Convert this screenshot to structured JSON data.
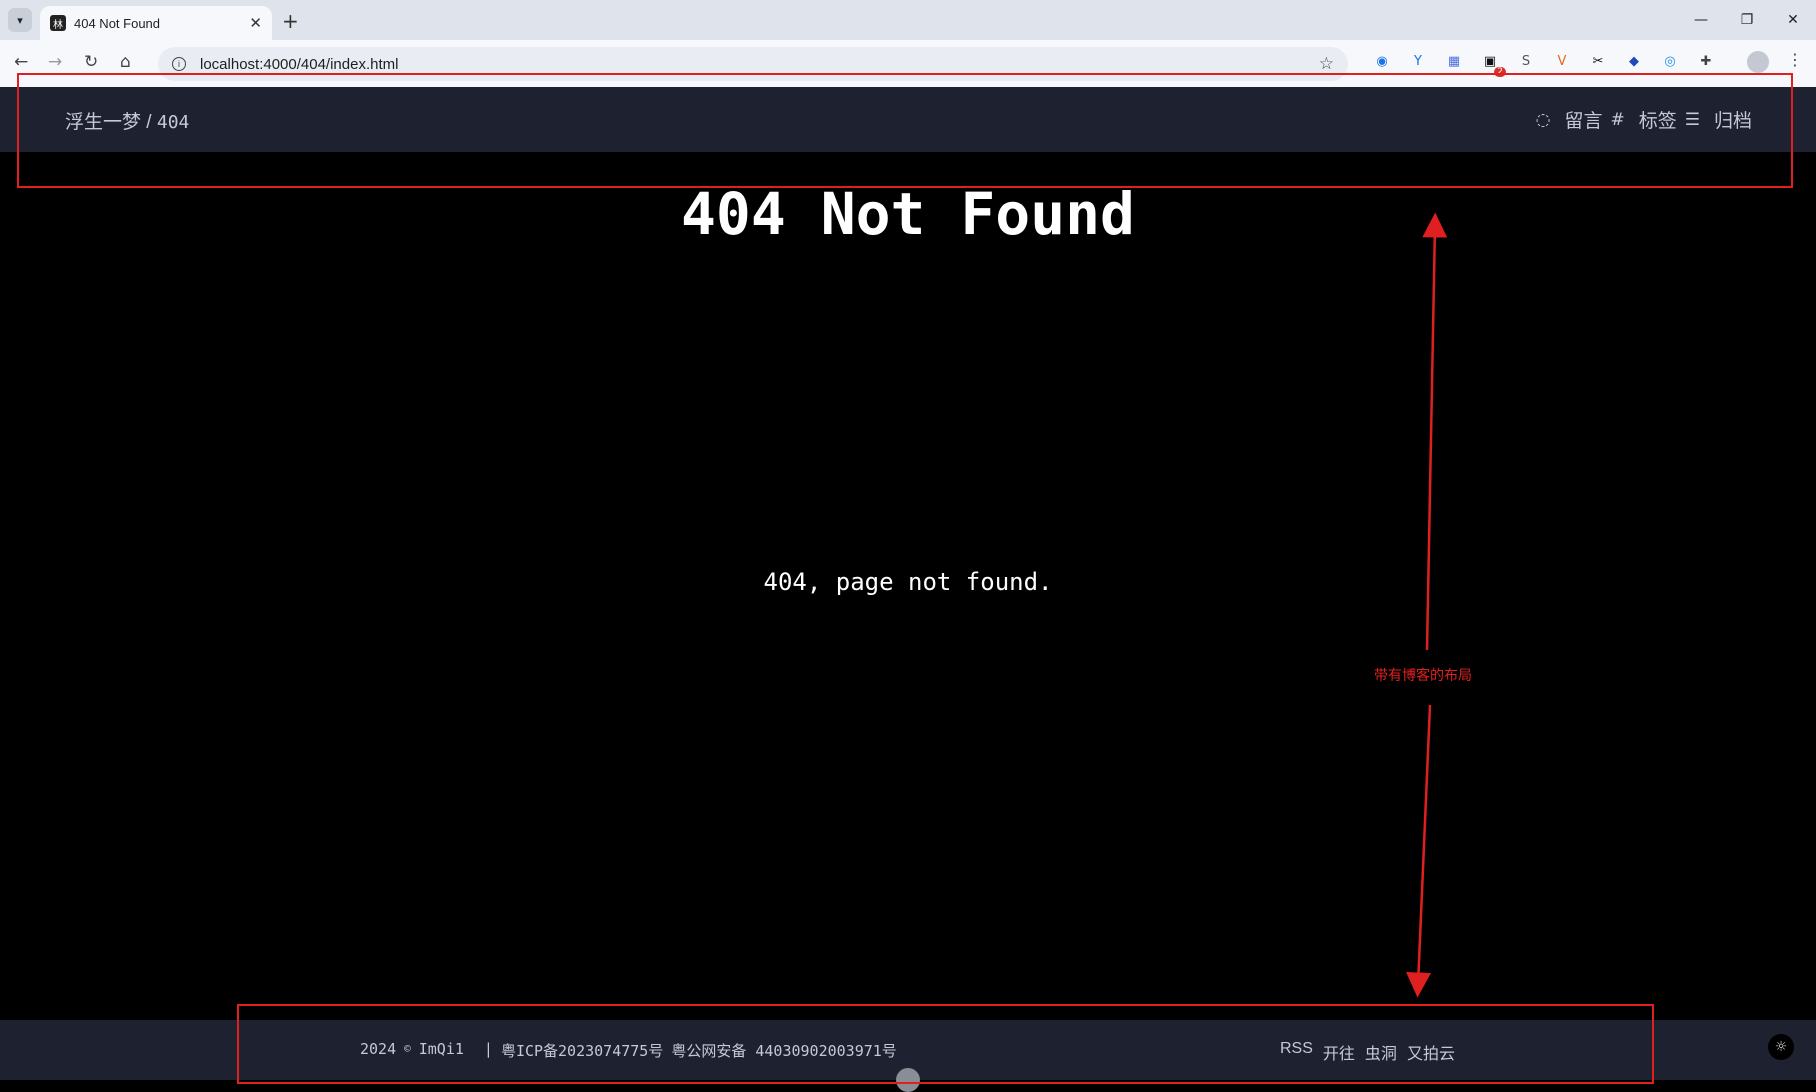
{
  "browser": {
    "tab_list_icon": "chevron-down-icon",
    "tab": {
      "favicon_text": "林",
      "title": "404 Not Found",
      "close": "✕"
    },
    "new_tab": "+",
    "window_controls": {
      "minimize": "—",
      "restore": "❐",
      "close": "✕"
    },
    "nav": {
      "back": "←",
      "forward": "→",
      "reload": "↻",
      "home": "⌂"
    },
    "url": "localhost:4000/404/index.html",
    "bookmark_star": "☆",
    "extensions": [
      {
        "name": "chrome-ext-icon",
        "glyph": "◉",
        "color": "#1a73e8"
      },
      {
        "name": "v-ext-icon",
        "glyph": "Y",
        "color": "#1a73e8"
      },
      {
        "name": "grid-ext-icon",
        "glyph": "▦",
        "color": "#4a6fdc"
      },
      {
        "name": "chat-ext-icon",
        "glyph": "▣",
        "color": "#111",
        "badge": "2"
      },
      {
        "name": "s-ext-icon",
        "glyph": "S",
        "color": "#555"
      },
      {
        "name": "v-logo-ext-icon",
        "glyph": "V",
        "color": "#e06a1b"
      },
      {
        "name": "scissors-ext-icon",
        "glyph": "✂",
        "color": "#111"
      },
      {
        "name": "circle-ext-icon",
        "glyph": "◆",
        "color": "#1e4bb8"
      },
      {
        "name": "eye-ext-icon",
        "glyph": "◎",
        "color": "#1e8ee8"
      },
      {
        "name": "puzzle-ext-icon",
        "glyph": "✚",
        "color": "#444"
      }
    ],
    "menu": "⋮"
  },
  "site": {
    "brand": "浮生一梦",
    "separator": "/",
    "page": "404",
    "nav": [
      {
        "icon": "comment-icon",
        "glyph": "◌",
        "label": "留言"
      },
      {
        "icon": "hashtag-icon",
        "glyph": "#",
        "label": "标签"
      },
      {
        "icon": "list-icon",
        "glyph": "☰",
        "label": "归档"
      }
    ]
  },
  "main": {
    "title": "404 Not Found",
    "message": "404, page not found."
  },
  "footer": {
    "year": "2024",
    "copyright_symbol": "©",
    "author": "ImQi1",
    "divider": "|",
    "icp": "粤ICP备2023074775号",
    "police": "粤公网安备 44030902003971号",
    "links": [
      "RSS",
      "开往",
      "虫洞",
      "又拍云"
    ],
    "theme_toggle": "☼"
  },
  "annotation": {
    "label": "带有博客的布局",
    "color": "#e02020"
  }
}
